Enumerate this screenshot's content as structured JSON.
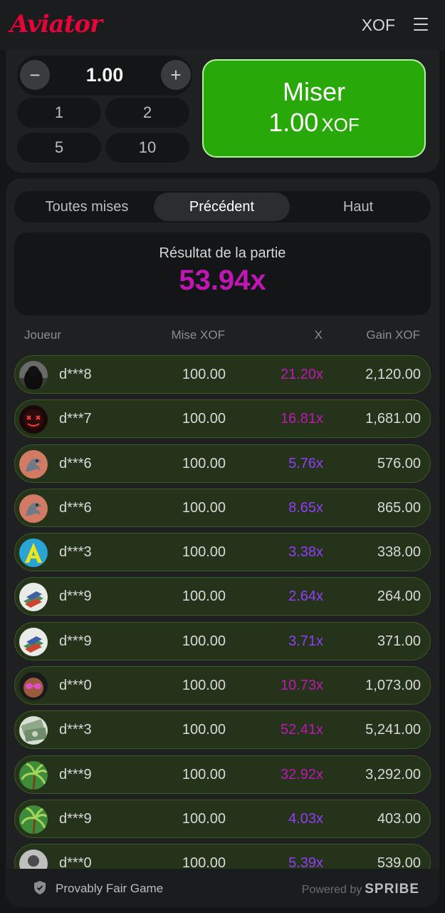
{
  "header": {
    "logo": "Aviator",
    "currency": "XOF"
  },
  "bet_panel": {
    "stake": "1.00",
    "minus": "−",
    "plus": "+",
    "quick": [
      "1",
      "2",
      "5",
      "10"
    ],
    "bet_button": {
      "label": "Miser",
      "amount": "1.00",
      "currency": "XOF"
    }
  },
  "tabs": [
    "Toutes mises",
    "Précédent",
    "Haut"
  ],
  "active_tab": "Précédent",
  "result": {
    "label": "Résultat de la partie",
    "value": "53.94x"
  },
  "columns": {
    "player": "Joueur",
    "bet": "Mise XOF",
    "multiplier": "X",
    "win": "Gain XOF"
  },
  "rows": [
    {
      "player": "d***8",
      "bet": "100.00",
      "mult": "21.20x",
      "win": "2,120.00",
      "mult_color": "magenta",
      "avatar": "hooded-figure"
    },
    {
      "player": "d***7",
      "bet": "100.00",
      "mult": "16.81x",
      "win": "1,681.00",
      "mult_color": "magenta",
      "avatar": "neon-mask"
    },
    {
      "player": "d***6",
      "bet": "100.00",
      "mult": "5.76x",
      "win": "576.00",
      "mult_color": "purple",
      "avatar": "dragon"
    },
    {
      "player": "d***6",
      "bet": "100.00",
      "mult": "8.65x",
      "win": "865.00",
      "mult_color": "purple",
      "avatar": "dragon"
    },
    {
      "player": "d***3",
      "bet": "100.00",
      "mult": "3.38x",
      "win": "338.00",
      "mult_color": "purple",
      "avatar": "letter-a"
    },
    {
      "player": "d***9",
      "bet": "100.00",
      "mult": "2.64x",
      "win": "264.00",
      "mult_color": "purple",
      "avatar": "books"
    },
    {
      "player": "d***9",
      "bet": "100.00",
      "mult": "3.71x",
      "win": "371.00",
      "mult_color": "purple",
      "avatar": "books"
    },
    {
      "player": "d***0",
      "bet": "100.00",
      "mult": "10.73x",
      "win": "1,073.00",
      "mult_color": "magenta",
      "avatar": "baby-glasses"
    },
    {
      "player": "d***3",
      "bet": "100.00",
      "mult": "52.41x",
      "win": "5,241.00",
      "mult_color": "magenta",
      "avatar": "money"
    },
    {
      "player": "d***9",
      "bet": "100.00",
      "mult": "32.92x",
      "win": "3,292.00",
      "mult_color": "magenta",
      "avatar": "palm"
    },
    {
      "player": "d***9",
      "bet": "100.00",
      "mult": "4.03x",
      "win": "403.00",
      "mult_color": "purple",
      "avatar": "palm"
    },
    {
      "player": "d***0",
      "bet": "100.00",
      "mult": "5.39x",
      "win": "539.00",
      "mult_color": "purple",
      "avatar": "person"
    }
  ],
  "footer": {
    "fair": "Provably Fair Game",
    "powered": "Powered by",
    "brand": "SPRIBE"
  },
  "colors": {
    "accent_red": "#e50539",
    "bet_green": "#28a909",
    "mult_purple": "#913ef8",
    "mult_magenta": "#c017b4",
    "row_bg": "#24331a"
  }
}
